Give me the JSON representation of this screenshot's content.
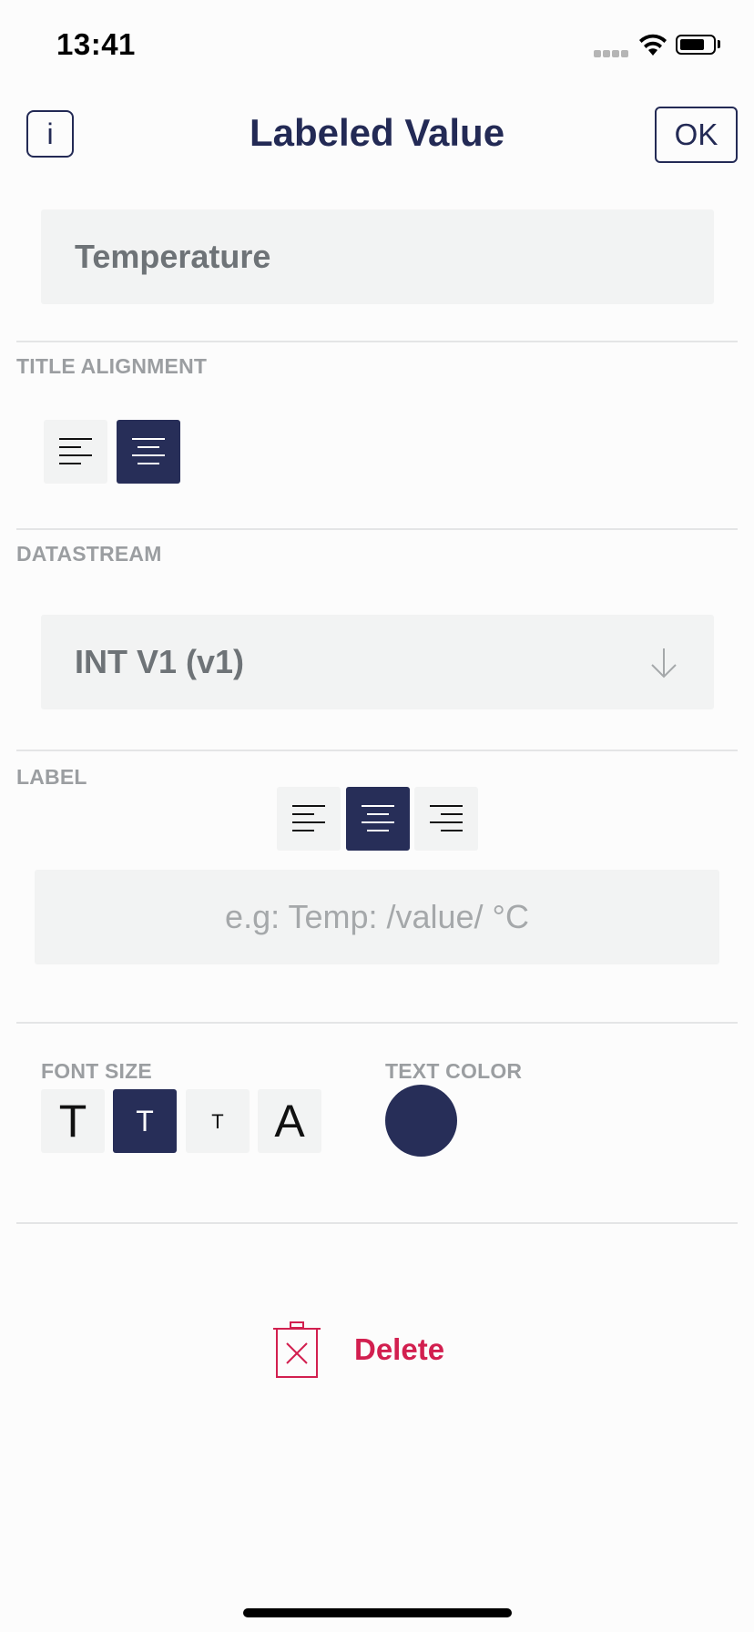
{
  "status_bar": {
    "time": "13:41",
    "wifi_icon": "wifi-icon",
    "battery_icon": "battery-icon"
  },
  "nav": {
    "info_label": "i",
    "title": "Labeled Value",
    "ok_label": "OK"
  },
  "widget_name": {
    "value": "Temperature"
  },
  "title_alignment": {
    "label": "TITLE ALIGNMENT",
    "options": [
      "align-left",
      "align-center"
    ],
    "selected": "align-center"
  },
  "datastream": {
    "label": "DATASTREAM",
    "value": "INT V1 (v1)",
    "dropdown_icon": "arrow-down-icon"
  },
  "label_section": {
    "label": "LABEL",
    "alignment_options": [
      "align-left",
      "align-center",
      "align-right"
    ],
    "selected": "align-center",
    "placeholder": "e.g: Temp: /value/ °C"
  },
  "font_size": {
    "label": "FONT SIZE",
    "options": [
      {
        "glyph": "T",
        "name": "large"
      },
      {
        "glyph": "T",
        "name": "medium"
      },
      {
        "glyph": "T",
        "name": "small"
      },
      {
        "glyph": "A",
        "name": "auto"
      }
    ],
    "selected": "medium"
  },
  "text_color": {
    "label": "TEXT COLOR",
    "value": "#272e58"
  },
  "delete": {
    "label": "Delete",
    "icon": "trash-icon",
    "color": "#d21f4f"
  },
  "colors": {
    "accent": "#272e58",
    "field_bg": "#f2f3f3",
    "danger": "#d21f4f"
  }
}
